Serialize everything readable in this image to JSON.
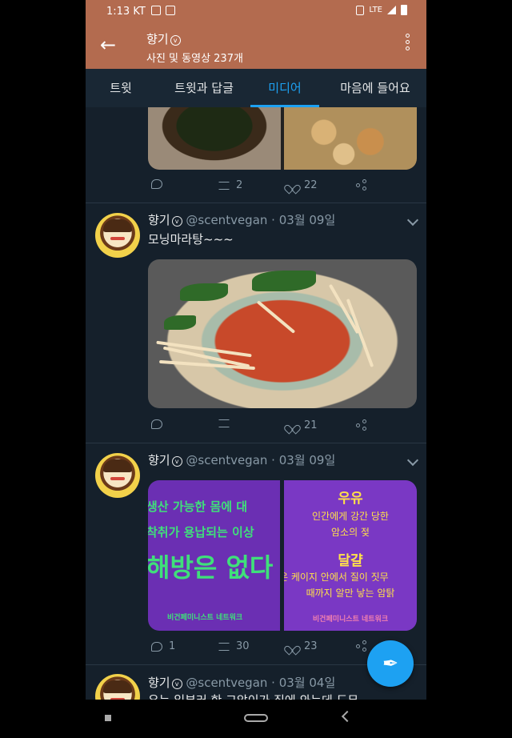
{
  "status_bar": {
    "time": "1:13",
    "carrier": "KT",
    "network": "LTE"
  },
  "app_bar": {
    "title": "향기",
    "subtitle": "사진 및 동영상 237개"
  },
  "tabs": [
    {
      "label": "트윗"
    },
    {
      "label": "트윗과 답글"
    },
    {
      "label": "미디어",
      "active": true
    },
    {
      "label": "마음에 들어요"
    }
  ],
  "tweets": [
    {
      "retweets": "2",
      "likes": "22"
    },
    {
      "name": "향기",
      "handle": "@scentvegan",
      "date": " · 03월 09일",
      "text": "모닝마라탕~~~",
      "retweets": "",
      "likes": "21"
    },
    {
      "name": "향기",
      "handle": "@scentvegan",
      "date": " · 03월 09일",
      "replies": "1",
      "retweets": "30",
      "likes": "23",
      "poster_left": {
        "line1": "생산 가능한 몸에 대",
        "line2": "착취가 용납되는 이상",
        "line3": "해방은 없다",
        "footer": "비건페미니스트 네트워크"
      },
      "poster_right": {
        "heading1": "우유",
        "text1a": "인간에게 강간 당한",
        "text1b": "암소의 젖",
        "heading2": "달걀",
        "text2a": "은 케이지 안에서 질이 짓무",
        "text2b": "때까지 알만 낳는 암탉",
        "footer": "비건페미니스트 네트워크"
      }
    },
    {
      "name": "향기",
      "handle": "@scentvegan",
      "date": " · 03월 04일",
      "text": "우는 일부러 한 그악이가 집에 와는데 도무"
    }
  ],
  "colors": {
    "header": "#b36b4f",
    "background": "#15202b",
    "accent": "#1da1f2"
  }
}
